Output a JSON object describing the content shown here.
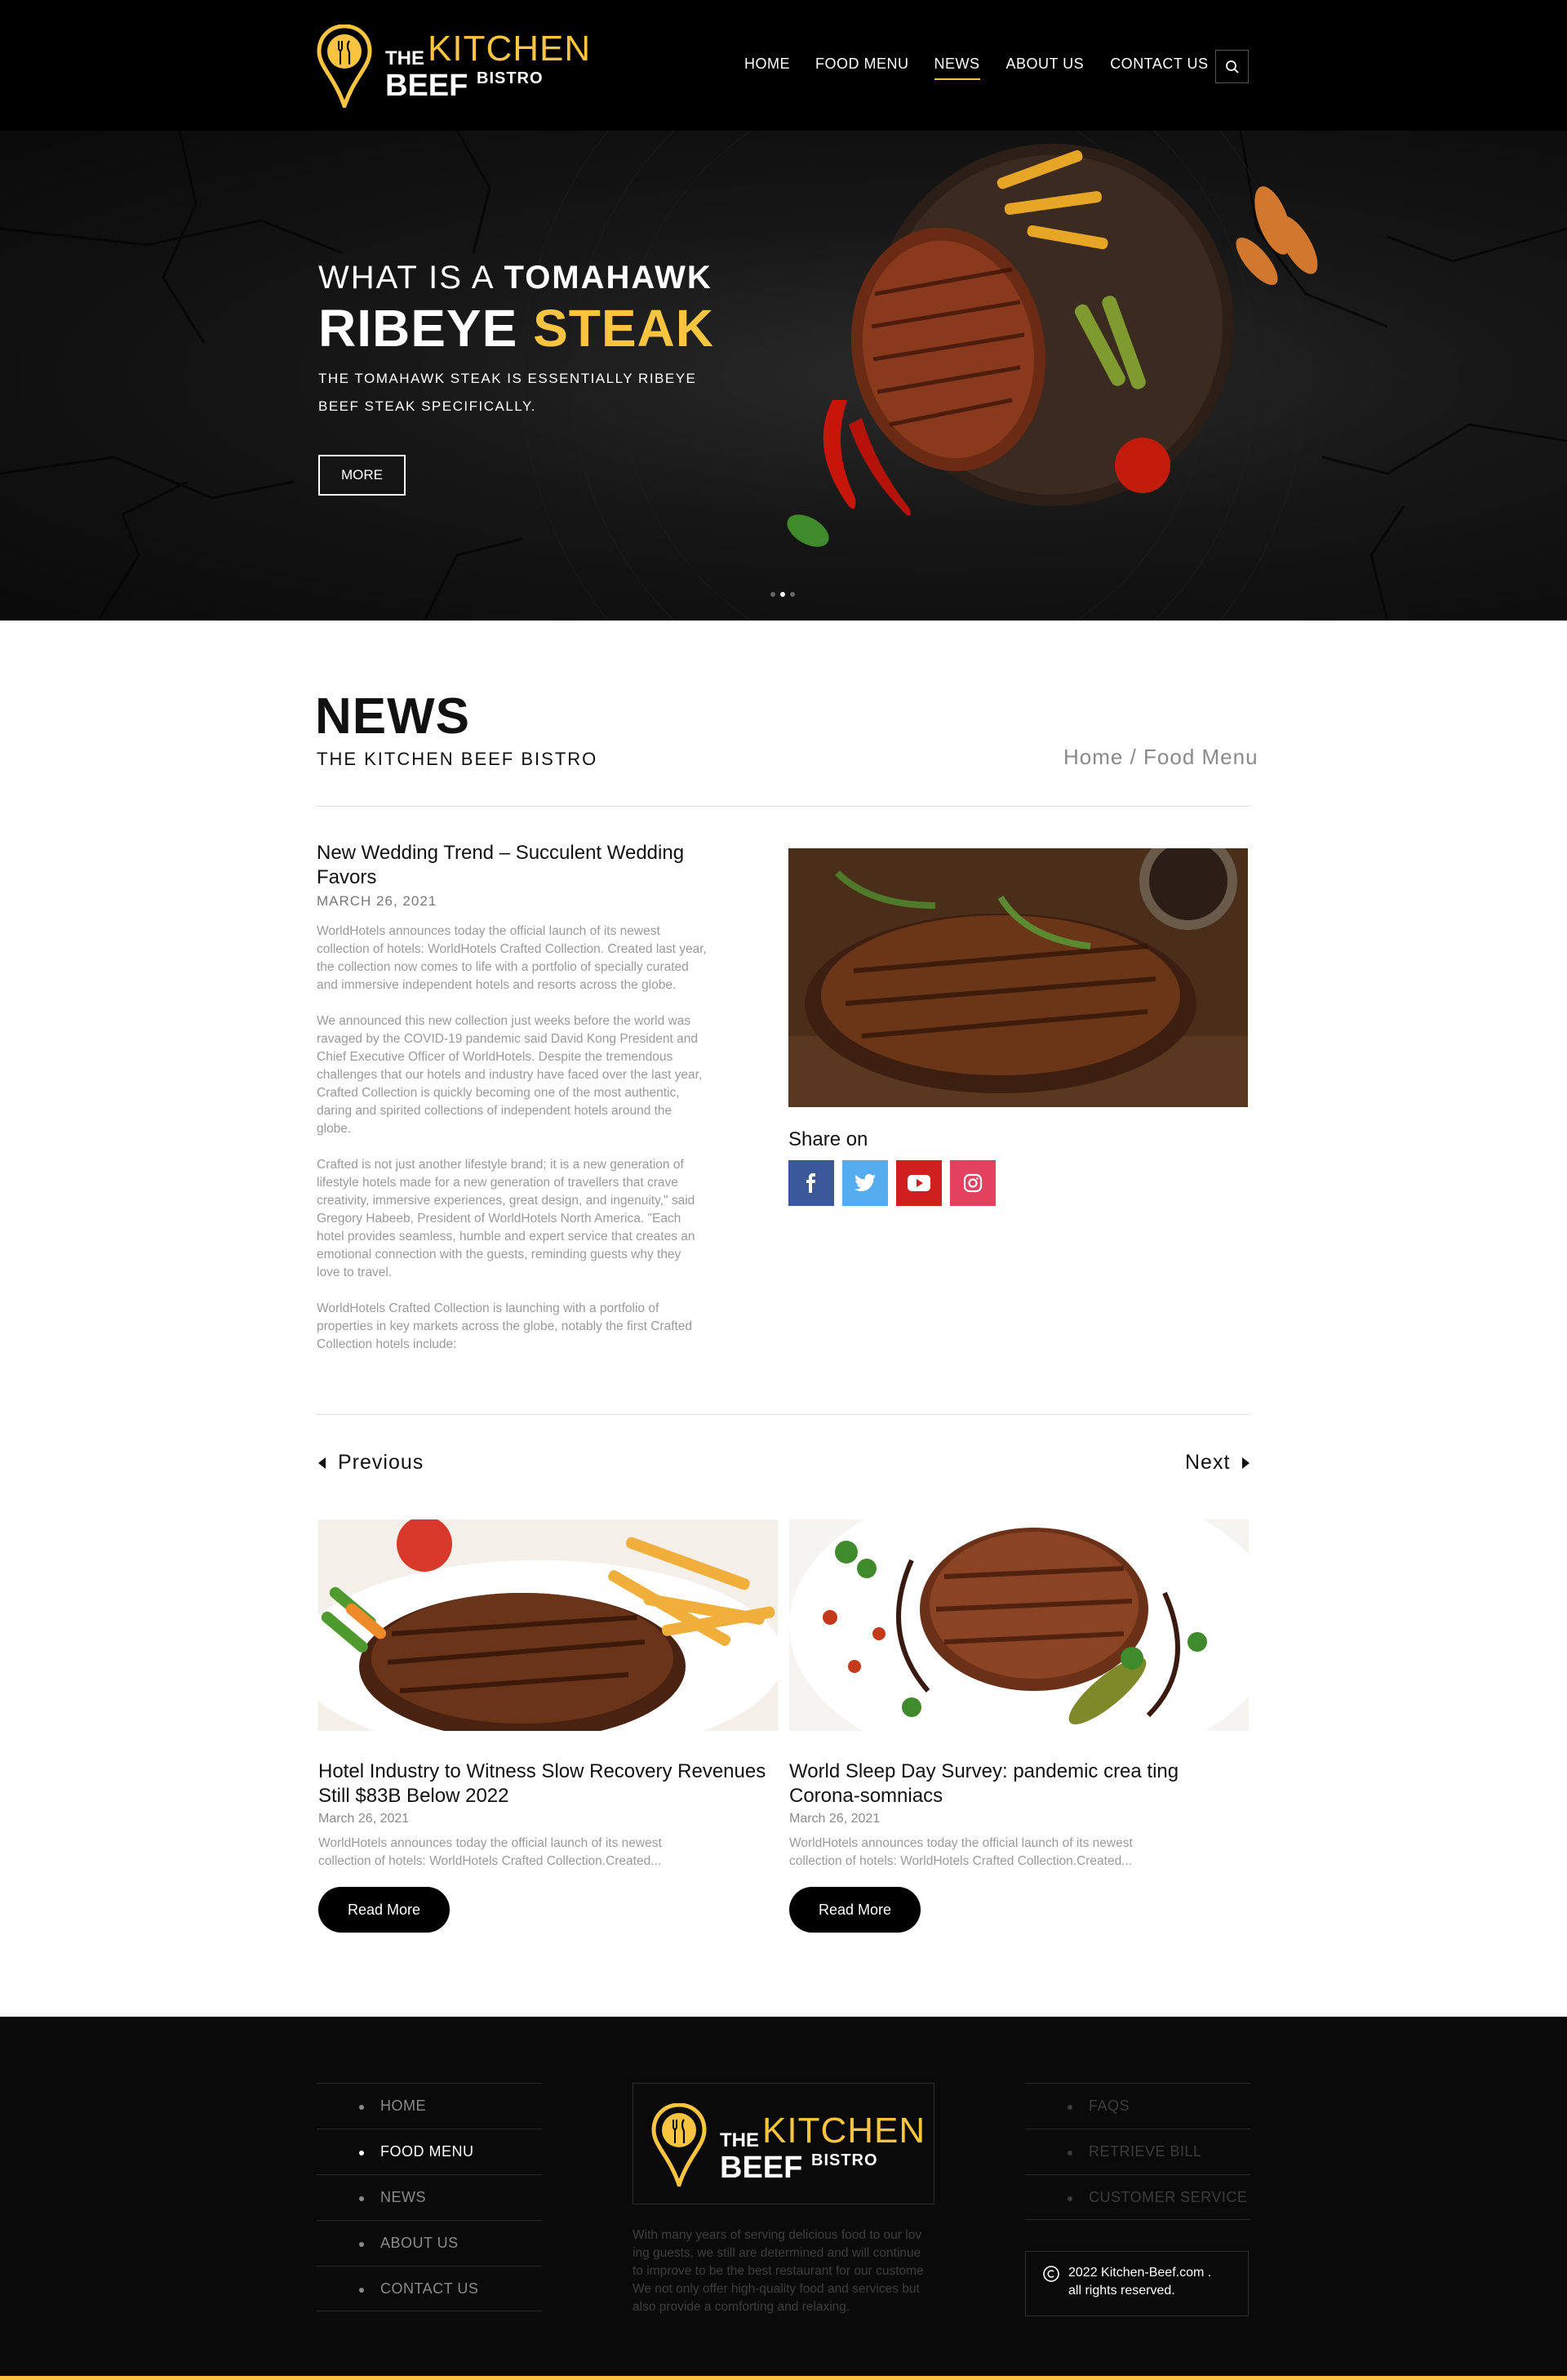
{
  "brand": {
    "the": "THE",
    "kitchen": "KITCHEN",
    "beef": "BEEF",
    "bistro": "BISTRO",
    "accent_color": "#f9c541"
  },
  "nav": {
    "items": [
      {
        "label": "HOME"
      },
      {
        "label": "FOOD MENU"
      },
      {
        "label": "NEWS",
        "active": true
      },
      {
        "label": "ABOUT US"
      },
      {
        "label": "CONTACT US"
      }
    ],
    "search_icon": "search-icon"
  },
  "hero": {
    "line1_prefix": "WHAT IS A",
    "line1_bold": "TOMAHAWK",
    "line2_white": "RIBEYE",
    "line2_gold": "STEAK",
    "description": "THE TOMAHAWK STEAK IS ESSENTIALLY RIBEYE BEEF STEAK SPECIFICALLY.",
    "button": "MORE",
    "slide_count": 3,
    "active_slide": 2
  },
  "page": {
    "title": "NEWS",
    "subtitle": "THE KITCHEN BEEF BISTRO",
    "breadcrumb": "Home / Food Menu"
  },
  "article": {
    "title": "New Wedding Trend – Succulent Wedding Favors",
    "date": "MARCH 26, 2021",
    "paragraphs": [
      "WorldHotels announces today the official launch of its newest collection of hotels: WorldHotels Crafted Collection.  Created last year, the collection now comes to life with a portfolio of specially curated and immersive independent hotels and resorts across the globe.",
      "We announced this new collection just weeks before the world was ravaged by the COVID-19 pandemic said David Kong President and Chief Executive Officer of WorldHotels. Despite the tremendous challenges that our hotels and industry have faced over the last year, Crafted Collection is quickly becoming one of the most authentic, daring and spirited collections of independent hotels around the globe.",
      "Crafted is not just another lifestyle brand; it is a new generation of lifestyle hotels made for a new generation of travellers that crave creativity, immersive experiences, great design, and ingenuity,\" said Gregory Habeeb, President of WorldHotels North America. \"Each hotel provides seamless, humble and expert service that creates an emotional connection with the guests, reminding guests why they love to travel.",
      "WorldHotels Crafted Collection is launching with a portfolio of properties in key markets across the globe, notably the first Crafted Collection hotels include:"
    ]
  },
  "share": {
    "label": "Share on",
    "buttons": [
      {
        "icon": "facebook-icon",
        "color": "#3b5998"
      },
      {
        "icon": "twitter-icon",
        "color": "#55acee"
      },
      {
        "icon": "youtube-icon",
        "color": "#cd201f"
      },
      {
        "icon": "instagram-icon",
        "color": "#e4405f"
      }
    ]
  },
  "pager": {
    "previous": "Previous",
    "next": "Next"
  },
  "cards": [
    {
      "title": "Hotel Industry to Witness Slow Recovery Revenues Still $83B Below 2022",
      "date": "March 26, 2021",
      "excerpt": "WorldHotels announces today the official launch of its newest collection of hotels: WorldHotels Crafted Collection.Created...",
      "button": "Read More"
    },
    {
      "title": "World Sleep Day Survey: pandemic crea ting Corona-somniacs",
      "date": "March 26, 2021",
      "excerpt": "WorldHotels announces today the official launch of its newest collection of hotels: WorldHotels Crafted Collection.Created...",
      "button": "Read More"
    }
  ],
  "footer": {
    "left_links": [
      {
        "label": "HOME"
      },
      {
        "label": "FOOD MENU",
        "active": true
      },
      {
        "label": "NEWS"
      },
      {
        "label": "ABOUT US"
      },
      {
        "label": "CONTACT US"
      }
    ],
    "right_links": [
      {
        "label": "FAQS"
      },
      {
        "label": "RETRIEVE BILL"
      },
      {
        "label": "CUSTOMER SERVICE"
      }
    ],
    "description": "With many years of serving delicious food to our lov ing guests, we still are determined and will continue to improve to be the best restaurant for our custome We not only offer high-quality food and services but also provide a comforting and relaxing.",
    "copyright_line1": "2022 Kitchen-Beef.com .",
    "copyright_line2": "all rights reserved.",
    "copyright_icon": "copyright-icon"
  }
}
